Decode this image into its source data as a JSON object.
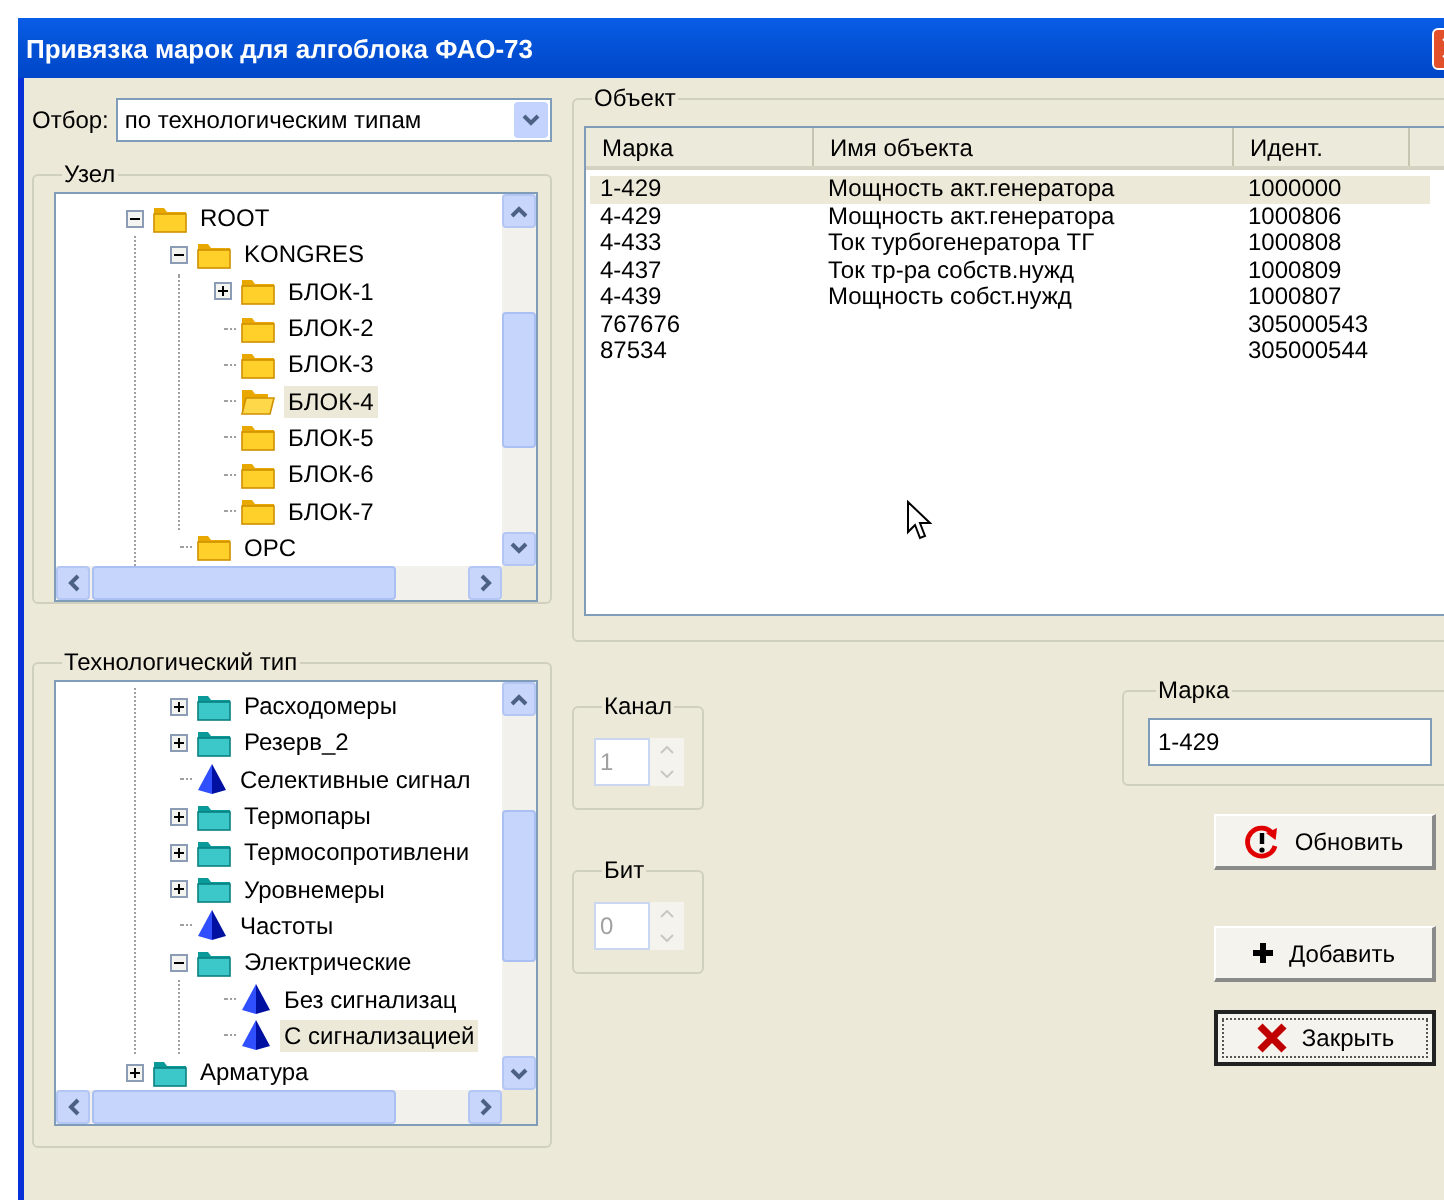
{
  "window": {
    "title": "Привязка марок для алгоблока ФАО-73"
  },
  "filter": {
    "label": "Отбор:",
    "value": "по технологическим типам"
  },
  "node_tree": {
    "title": "Узел",
    "items": [
      {
        "label": "ROOT",
        "kind": "folder",
        "expanded": true,
        "selected": false,
        "children": [
          {
            "label": "KONGRES",
            "kind": "folder",
            "expanded": true,
            "selected": false,
            "children": [
              {
                "label": "БЛОК-1",
                "kind": "folder",
                "expanded": false,
                "selected": false
              },
              {
                "label": "БЛОК-2",
                "kind": "folder",
                "selected": false
              },
              {
                "label": "БЛОК-3",
                "kind": "folder",
                "selected": false
              },
              {
                "label": "БЛОК-4",
                "kind": "folder",
                "selected": true
              },
              {
                "label": "БЛОК-5",
                "kind": "folder",
                "selected": false
              },
              {
                "label": "БЛОК-6",
                "kind": "folder",
                "selected": false
              },
              {
                "label": "БЛОК-7",
                "kind": "folder",
                "selected": false
              }
            ]
          },
          {
            "label": "OPC",
            "kind": "folder",
            "selected": false
          }
        ]
      }
    ]
  },
  "type_tree": {
    "title": "Технологический тип",
    "items": [
      {
        "kind": "continuation",
        "children": [
          {
            "label": "Расходомеры",
            "kind": "folder",
            "expanded": false,
            "selected": false
          },
          {
            "label": "Резерв_2",
            "kind": "folder",
            "expanded": false,
            "selected": false
          },
          {
            "label": "Селективные сигнал",
            "kind": "leaf",
            "selected": false
          },
          {
            "label": "Термопары",
            "kind": "folder",
            "expanded": false,
            "selected": false
          },
          {
            "label": "Термосопротивлени",
            "kind": "folder",
            "expanded": false,
            "selected": false
          },
          {
            "label": "Уровнемеры",
            "kind": "folder",
            "expanded": false,
            "selected": false
          },
          {
            "label": "Частоты",
            "kind": "leaf",
            "selected": false
          },
          {
            "label": "Электрические",
            "kind": "folder",
            "expanded": true,
            "selected": false,
            "children": [
              {
                "label": "Без сигнализац",
                "kind": "leaf",
                "selected": false
              },
              {
                "label": "С сигнализацией",
                "kind": "leaf",
                "selected": true
              }
            ]
          }
        ]
      },
      {
        "label": "Арматура",
        "kind": "folder",
        "expanded": false,
        "selected": false
      }
    ]
  },
  "object": {
    "title": "Объект",
    "columns": [
      "Марка",
      "Имя объекта",
      "Идент."
    ],
    "rows": [
      {
        "cells": [
          "1-429",
          "Мощность акт.генератора",
          "1000000"
        ],
        "selected": true
      },
      {
        "cells": [
          "4-429",
          "Мощность акт.генератора",
          "1000806"
        ],
        "selected": false
      },
      {
        "cells": [
          "4-433",
          "Ток турбогенератора ТГ",
          "1000808"
        ],
        "selected": false
      },
      {
        "cells": [
          "4-437",
          "Ток  тр-ра собств.нужд",
          "1000809"
        ],
        "selected": false
      },
      {
        "cells": [
          "4-439",
          "Мощность  собст.нужд",
          "1000807"
        ],
        "selected": false
      },
      {
        "cells": [
          "767676",
          "",
          "305000543"
        ],
        "selected": false
      },
      {
        "cells": [
          "87534",
          "",
          "305000544"
        ],
        "selected": false
      }
    ]
  },
  "channel": {
    "title": "Канал",
    "value": "1",
    "disabled": true
  },
  "bit": {
    "title": "Бит",
    "value": "0",
    "disabled": true
  },
  "mark": {
    "title": "Марка",
    "value": "1-429"
  },
  "buttons": [
    {
      "kind": "refresh",
      "label": "Обновить",
      "focused": false
    },
    {
      "kind": "add",
      "label": "Добавить",
      "focused": false
    },
    {
      "kind": "close",
      "label": "Закрыть",
      "focused": true
    }
  ]
}
